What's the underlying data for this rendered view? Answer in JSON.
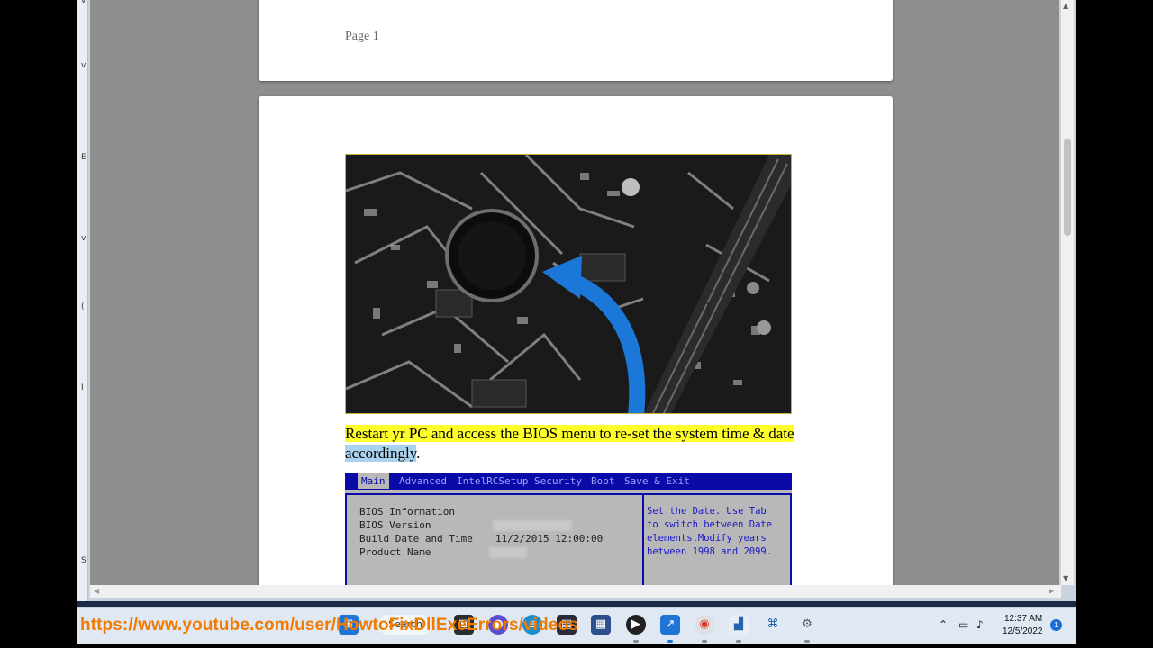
{
  "viewer": {
    "page_label": "Page 1",
    "instruction_highlighted": "Restart yr PC and access the BIOS menu to re-set the system time & date",
    "instruction_selected": "accordingly",
    "instruction_trailing": "."
  },
  "bios": {
    "tabs": [
      "Main",
      "Advanced",
      "IntelRCSetup",
      "Security",
      "Boot",
      "Save & Exit"
    ],
    "active_tab": "Main",
    "rows": [
      {
        "label": "BIOS Information",
        "value": ""
      },
      {
        "label": "BIOS Version",
        "value": ""
      },
      {
        "label": "Build Date and Time",
        "value": "11/2/2015 12:00:00"
      },
      {
        "label": "Product Name",
        "value": ""
      }
    ],
    "help_lines": [
      "Set the Date. Use Tab",
      "to switch between Date",
      "elements.Modify years",
      "between 1998 and 2099."
    ],
    "colors": {
      "menubar": "#0a0aa8",
      "panel": "#b8b8b8",
      "help_text": "#1818c8"
    }
  },
  "taskbar": {
    "overlay_url": "https://www.youtube.com/user/HowtoFixDllExeErrors/videos",
    "search_label": "Search",
    "time": "12:37 AM",
    "date": "12/5/2022",
    "notification_count": "1",
    "overlay_color": "#f07b00"
  },
  "left_strip_glyphs": [
    "v",
    "v",
    "E",
    "v",
    "(",
    "I",
    "S"
  ],
  "icons": [
    "windows-start-icon",
    "task-view-icon",
    "chat-icon",
    "edge-icon",
    "file-explorer-icon",
    "store-icon",
    "media-player-icon",
    "stocks-icon",
    "chrome-icon",
    "resource-monitor-icon",
    "network-icon",
    "settings-icon"
  ]
}
